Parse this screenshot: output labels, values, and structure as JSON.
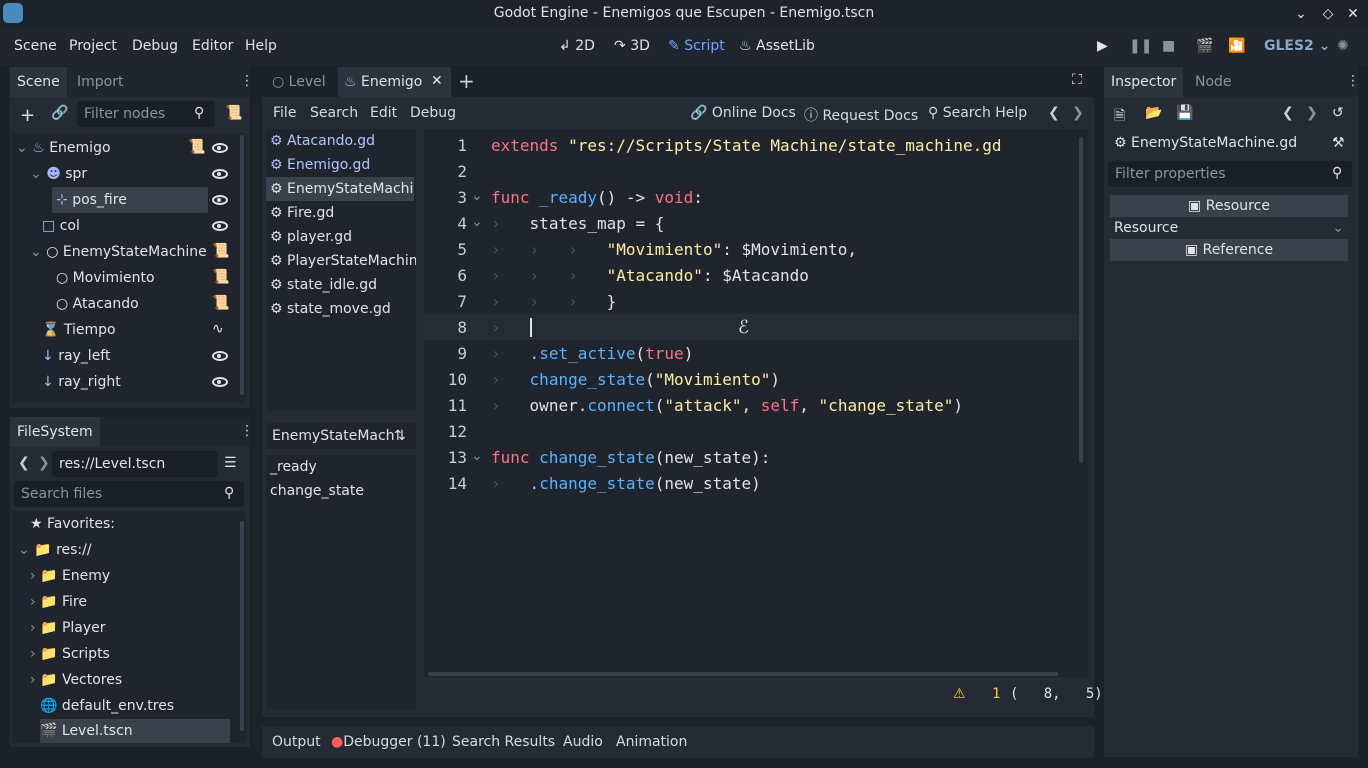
{
  "window": {
    "title": "Godot Engine - Enemigos que Escupen - Enemigo.tscn"
  },
  "menu": [
    "Scene",
    "Project",
    "Debug",
    "Editor",
    "Help"
  ],
  "workspaces": [
    {
      "label": "2D",
      "icon": "2d-icon"
    },
    {
      "label": "3D",
      "icon": "3d-icon"
    },
    {
      "label": "Script",
      "icon": "script-icon"
    },
    {
      "label": "AssetLib",
      "icon": "assetlib-icon"
    }
  ],
  "renderer": "GLES2",
  "scene_dock": {
    "tabs": [
      "Scene",
      "Import"
    ],
    "filter_placeholder": "Filter nodes",
    "nodes": [
      {
        "label": "Enemigo",
        "depth": 0,
        "icon": "kinematic-body-icon"
      },
      {
        "label": "spr",
        "depth": 1,
        "icon": "sprite-icon"
      },
      {
        "label": "pos_fire",
        "depth": 2,
        "icon": "position-icon"
      },
      {
        "label": "col",
        "depth": 1,
        "icon": "collision-shape-icon"
      },
      {
        "label": "EnemyStateMachine",
        "depth": 1,
        "icon": "node-icon"
      },
      {
        "label": "Movimiento",
        "depth": 2,
        "icon": "node-icon"
      },
      {
        "label": "Atacando",
        "depth": 2,
        "icon": "node-icon"
      },
      {
        "label": "Tiempo",
        "depth": 1,
        "icon": "timer-icon"
      },
      {
        "label": "ray_left",
        "depth": 1,
        "icon": "raycast-icon"
      },
      {
        "label": "ray_right",
        "depth": 1,
        "icon": "raycast-icon"
      }
    ]
  },
  "filesystem": {
    "tab": "FileSystem",
    "path": "res://Level.tscn",
    "search_placeholder": "Search files",
    "items": [
      {
        "label": "Favorites:",
        "icon": "star-icon"
      },
      {
        "label": "res://",
        "icon": "folder-icon"
      },
      {
        "label": "Enemy",
        "icon": "folder-icon"
      },
      {
        "label": "Fire",
        "icon": "folder-icon"
      },
      {
        "label": "Player",
        "icon": "folder-icon"
      },
      {
        "label": "Scripts",
        "icon": "folder-icon"
      },
      {
        "label": "Vectores",
        "icon": "folder-icon"
      },
      {
        "label": "default_env.tres",
        "icon": "globe-icon"
      },
      {
        "label": "Level.tscn",
        "icon": "scene-icon"
      }
    ]
  },
  "scene_tabs": [
    "Level",
    "Enemigo"
  ],
  "script_menu": [
    "File",
    "Search",
    "Edit",
    "Debug"
  ],
  "script_help": [
    "Online Docs",
    "Request Docs",
    "Search Help"
  ],
  "script_list": [
    "Atacando.gd",
    "Enemigo.gd",
    "EnemyStateMachin",
    "Fire.gd",
    "player.gd",
    "PlayerStateMachine",
    "state_idle.gd",
    "state_move.gd"
  ],
  "method_panel": {
    "title": "EnemyStateMach",
    "methods": [
      "_ready",
      "change_state"
    ]
  },
  "code": {
    "line_numbers": [
      "1",
      "2",
      "3",
      "4",
      "5",
      "6",
      "7",
      "8",
      "9",
      "10",
      "11",
      "12",
      "13",
      "14"
    ],
    "l1_kw": "extends",
    "l1_str": "\"res://Scripts/State Machine/state_machine.gd",
    "l3_kw": "func",
    "l3_fn": "_ready",
    "l3_rest": "() -> ",
    "l3_type": "void",
    "l3_colon": ":",
    "l4": "states_map = {",
    "l5_str": "\"Movimiento\"",
    "l5_rest": ": $Movimiento,",
    "l6_str": "\"Atacando\"",
    "l6_rest": ": $Atacando",
    "l7": "}",
    "l9_dot": ".",
    "l9_fn": "set_active",
    "l9_a": "(",
    "l9_kw": "true",
    "l9_b": ")",
    "l10_fn": "change_state",
    "l10_a": "(",
    "l10_str": "\"Movimiento\"",
    "l10_b": ")",
    "l11_a": "owner.",
    "l11_fn": "connect",
    "l11_b": "(",
    "l11_s1": "\"attack\"",
    "l11_c": ", ",
    "l11_kw": "self",
    "l11_d": ", ",
    "l11_s2": "\"change_state\"",
    "l11_e": ")",
    "l13_kw": "func",
    "l13_fn": "change_state",
    "l13_rest": "(new_state):",
    "l14_dot": ".",
    "l14_fn": "change_state",
    "l14_rest": "(new_state)"
  },
  "status": {
    "warnings": "1",
    "position": "(   8,   5)"
  },
  "bottom_tabs": [
    "Output",
    "Debugger (11)",
    "Search Results",
    "Audio",
    "Animation"
  ],
  "inspector": {
    "tabs": [
      "Inspector",
      "Node"
    ],
    "object": "EnemyStateMachine.gd",
    "filter_placeholder": "Filter properties",
    "section": "Resource",
    "category": "Resource",
    "sub_section": "Reference"
  },
  "colors": {
    "accent": "#6aa7ff",
    "keyword": "#ff7085",
    "string": "#ffeda1",
    "function": "#57b3ff"
  }
}
